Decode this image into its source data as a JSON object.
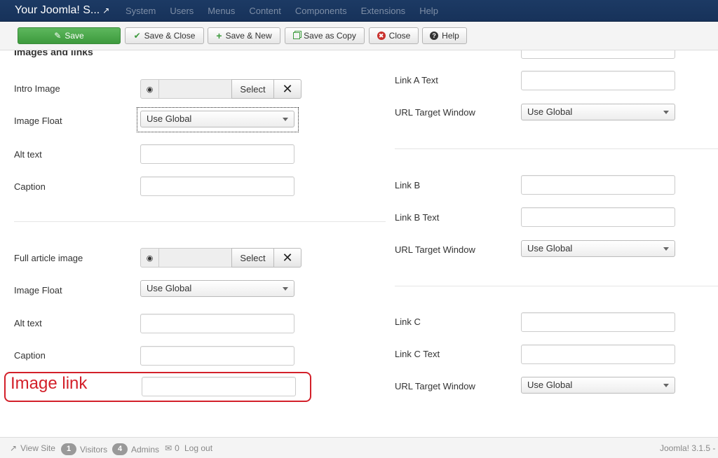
{
  "navbar": {
    "brand": "Your Joomla! S...",
    "brand_icon": "external-link-icon",
    "menu": [
      "System",
      "Users",
      "Menus",
      "Content",
      "Components",
      "Extensions",
      "Help"
    ]
  },
  "toolbar": {
    "save": "Save",
    "save_close": "Save & Close",
    "save_new": "Save & New",
    "save_copy": "Save as Copy",
    "close": "Close",
    "help": "Help"
  },
  "left": {
    "section_title": "Images and links",
    "intro_image_label": "Intro Image",
    "select_label": "Select",
    "image_float_label": "Image Float",
    "image_float_value": "Use Global",
    "alt_text_label": "Alt text",
    "caption_label": "Caption",
    "full_article_image_label": "Full article image",
    "full_select_label": "Select",
    "full_image_float_label": "Image Float",
    "full_image_float_value": "Use Global",
    "full_alt_text_label": "Alt text",
    "full_caption_label": "Caption"
  },
  "annotation": {
    "label": "Image link",
    "color": "#d3202a"
  },
  "right": {
    "link_a_text_label": "Link A Text",
    "url_target_a_label": "URL Target Window",
    "url_target_a_value": "Use Global",
    "link_b_label": "Link B",
    "link_b_text_label": "Link B Text",
    "url_target_b_label": "URL Target Window",
    "url_target_b_value": "Use Global",
    "link_c_label": "Link C",
    "link_c_text_label": "Link C Text",
    "url_target_c_label": "URL Target Window",
    "url_target_c_value": "Use Global"
  },
  "status": {
    "view_site": "View Site",
    "visitors_count": "1",
    "visitors": "Visitors",
    "admins_count": "4",
    "admins": "Admins",
    "messages_count": "0",
    "logout": "Log out",
    "version": "Joomla! 3.1.5 -"
  },
  "colors": {
    "navbar": "#1c3a64",
    "save_button": "#47a447",
    "annotation": "#d3202a"
  }
}
